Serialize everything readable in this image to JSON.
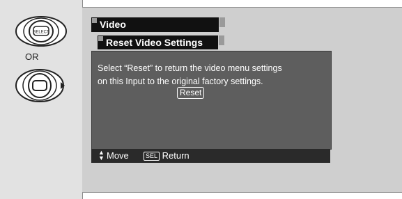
{
  "remote": {
    "or_label": "OR",
    "select_label": "SELECT"
  },
  "menu": {
    "title": "Video",
    "subtitle": "Reset Video Settings",
    "message_line1": "Select “Reset” to return the video menu settings",
    "message_line2": "on this Input to the original factory settings.",
    "reset_button": "Reset"
  },
  "footer": {
    "move_label": "Move",
    "sel_label": "SEL",
    "return_label": "Return"
  }
}
